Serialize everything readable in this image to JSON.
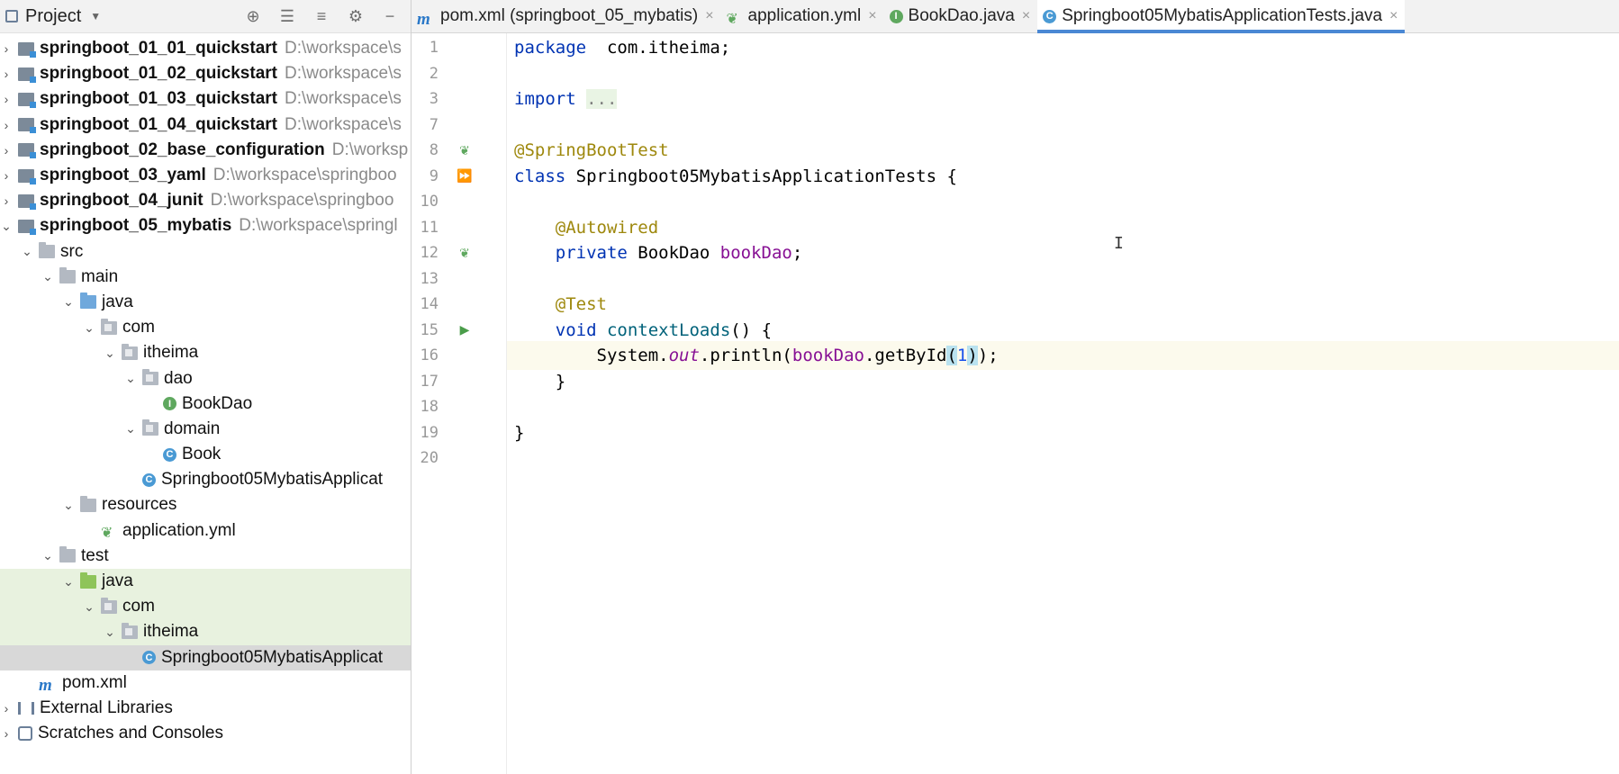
{
  "project_panel": {
    "title": "Project",
    "tree": [
      {
        "label": "springboot_01_01_quickstart",
        "path": "D:\\workspace\\s",
        "type": "module",
        "level": 0,
        "arrow": "›",
        "bold": true
      },
      {
        "label": "springboot_01_02_quickstart",
        "path": "D:\\workspace\\s",
        "type": "module",
        "level": 0,
        "arrow": "›",
        "bold": true
      },
      {
        "label": "springboot_01_03_quickstart",
        "path": "D:\\workspace\\s",
        "type": "module",
        "level": 0,
        "arrow": "›",
        "bold": true
      },
      {
        "label": "springboot_01_04_quickstart",
        "path": "D:\\workspace\\s",
        "type": "module",
        "level": 0,
        "arrow": "›",
        "bold": true
      },
      {
        "label": "springboot_02_base_configuration",
        "path": "D:\\worksp",
        "type": "module",
        "level": 0,
        "arrow": "›",
        "bold": true
      },
      {
        "label": "springboot_03_yaml",
        "path": "D:\\workspace\\springboo",
        "type": "module",
        "level": 0,
        "arrow": "›",
        "bold": true
      },
      {
        "label": "springboot_04_junit",
        "path": "D:\\workspace\\springboo",
        "type": "module",
        "level": 0,
        "arrow": "›",
        "bold": true
      },
      {
        "label": "springboot_05_mybatis",
        "path": "D:\\workspace\\springl",
        "type": "module",
        "level": 0,
        "arrow": "⌄",
        "bold": true
      },
      {
        "label": "src",
        "path": "",
        "type": "folder",
        "level": 1,
        "arrow": "⌄"
      },
      {
        "label": "main",
        "path": "",
        "type": "folder",
        "level": 2,
        "arrow": "⌄"
      },
      {
        "label": "java",
        "path": "",
        "type": "folder-blue",
        "level": 3,
        "arrow": "⌄"
      },
      {
        "label": "com",
        "path": "",
        "type": "package",
        "level": 4,
        "arrow": "⌄"
      },
      {
        "label": "itheima",
        "path": "",
        "type": "package",
        "level": 5,
        "arrow": "⌄"
      },
      {
        "label": "dao",
        "path": "",
        "type": "package",
        "level": 6,
        "arrow": "⌄"
      },
      {
        "label": "BookDao",
        "path": "",
        "type": "interface",
        "level": 7,
        "arrow": ""
      },
      {
        "label": "domain",
        "path": "",
        "type": "package",
        "level": 6,
        "arrow": "⌄"
      },
      {
        "label": "Book",
        "path": "",
        "type": "class",
        "level": 7,
        "arrow": ""
      },
      {
        "label": "Springboot05MybatisApplicat",
        "path": "",
        "type": "spring-class",
        "level": 6,
        "arrow": ""
      },
      {
        "label": "resources",
        "path": "",
        "type": "folder",
        "level": 3,
        "arrow": "⌄"
      },
      {
        "label": "application.yml",
        "path": "",
        "type": "yml",
        "level": 4,
        "arrow": ""
      },
      {
        "label": "test",
        "path": "",
        "type": "folder",
        "level": 2,
        "arrow": "⌄"
      },
      {
        "label": "java",
        "path": "",
        "type": "folder-green",
        "level": 3,
        "arrow": "⌄",
        "highlight": "green"
      },
      {
        "label": "com",
        "path": "",
        "type": "package",
        "level": 4,
        "arrow": "⌄",
        "highlight": "green"
      },
      {
        "label": "itheima",
        "path": "",
        "type": "package",
        "level": 5,
        "arrow": "⌄",
        "highlight": "green"
      },
      {
        "label": "Springboot05MybatisApplicat",
        "path": "",
        "type": "spring-class",
        "level": 6,
        "arrow": "",
        "highlight": "grey"
      },
      {
        "label": "pom.xml",
        "path": "",
        "type": "maven",
        "level": 1,
        "arrow": ""
      },
      {
        "label": "External Libraries",
        "path": "",
        "type": "library",
        "level": 0,
        "arrow": "›"
      },
      {
        "label": "Scratches and Consoles",
        "path": "",
        "type": "scratch",
        "level": 0,
        "arrow": "›"
      }
    ]
  },
  "tabs": [
    {
      "label": "pom.xml (springboot_05_mybatis)",
      "icon": "maven-icon",
      "active": false
    },
    {
      "label": "application.yml",
      "icon": "yml-icon",
      "active": false
    },
    {
      "label": "BookDao.java",
      "icon": "interface-icon",
      "active": false
    },
    {
      "label": "Springboot05MybatisApplicationTests.java",
      "icon": "spring-class-icon",
      "active": true
    }
  ],
  "editor": {
    "lines": [
      {
        "n": "1",
        "tokens": [
          [
            "kw",
            "package"
          ],
          [
            "",
            "  com.itheima;"
          ]
        ]
      },
      {
        "n": "2",
        "tokens": []
      },
      {
        "n": "3",
        "tokens": [
          [
            "kw",
            "import"
          ],
          [
            "",
            " "
          ],
          [
            "fold",
            "..."
          ]
        ]
      },
      {
        "n": "7",
        "tokens": []
      },
      {
        "n": "8",
        "tokens": [
          [
            "ann",
            "@SpringBootTest"
          ]
        ],
        "gutter": "spring-bean-icon"
      },
      {
        "n": "9",
        "tokens": [
          [
            "kw",
            "class"
          ],
          [
            "",
            " Springboot05MybatisApplicationTests {"
          ]
        ],
        "gutter": "run-all-icon"
      },
      {
        "n": "10",
        "tokens": []
      },
      {
        "n": "11",
        "tokens": [
          [
            "",
            "    "
          ],
          [
            "ann",
            "@Autowired"
          ]
        ]
      },
      {
        "n": "12",
        "tokens": [
          [
            "",
            "    "
          ],
          [
            "kw",
            "private"
          ],
          [
            "",
            " BookDao "
          ],
          [
            "fld",
            "bookDao"
          ],
          [
            "",
            ";"
          ]
        ],
        "gutter": "autowire-icon"
      },
      {
        "n": "13",
        "tokens": []
      },
      {
        "n": "14",
        "tokens": [
          [
            "",
            "    "
          ],
          [
            "ann",
            "@Test"
          ]
        ]
      },
      {
        "n": "15",
        "tokens": [
          [
            "",
            "    "
          ],
          [
            "kw",
            "void"
          ],
          [
            "",
            " "
          ],
          [
            "mth",
            "contextLoads"
          ],
          [
            "",
            "() {"
          ]
        ],
        "gutter": "run-icon"
      },
      {
        "n": "16",
        "tokens": [
          [
            "",
            "        System."
          ],
          [
            "it",
            "out"
          ],
          [
            "",
            ".println("
          ],
          [
            "fld",
            "bookDao"
          ],
          [
            "",
            ".getById"
          ],
          [
            "brk",
            "("
          ],
          [
            "num",
            "1"
          ],
          [
            "brk",
            ")"
          ],
          [
            "",
            ");"
          ]
        ],
        "current": true
      },
      {
        "n": "17",
        "tokens": [
          [
            "",
            "    }"
          ]
        ]
      },
      {
        "n": "18",
        "tokens": []
      },
      {
        "n": "19",
        "tokens": [
          [
            "",
            "}"
          ]
        ]
      },
      {
        "n": "20",
        "tokens": []
      }
    ]
  }
}
